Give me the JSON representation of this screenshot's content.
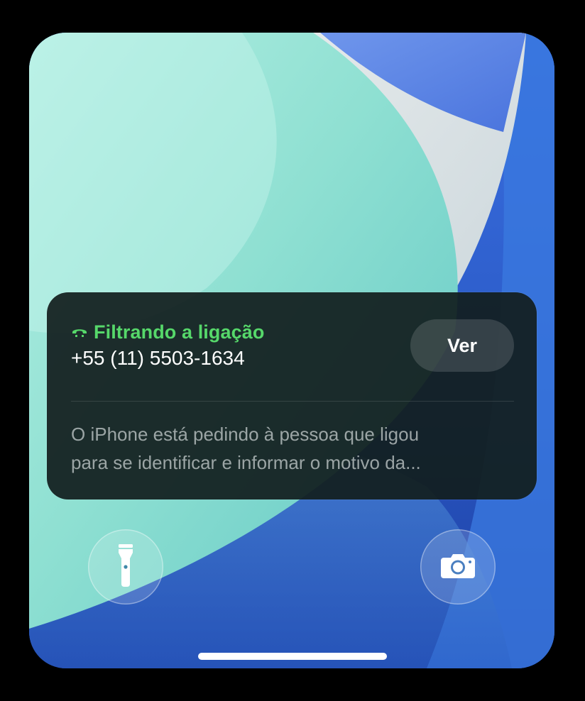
{
  "notification": {
    "icon": "phone-receiver-icon",
    "title": "Filtrando a ligação",
    "number": "+55 (11) 5503-1634",
    "action_label": "Ver",
    "body_line1": "O iPhone está pedindo à pessoa que ligou",
    "body_line2": "para se identificar e informar o motivo da...",
    "title_color": "#56d86a"
  },
  "quick_actions": {
    "left": "flashlight-icon",
    "right": "camera-icon"
  }
}
